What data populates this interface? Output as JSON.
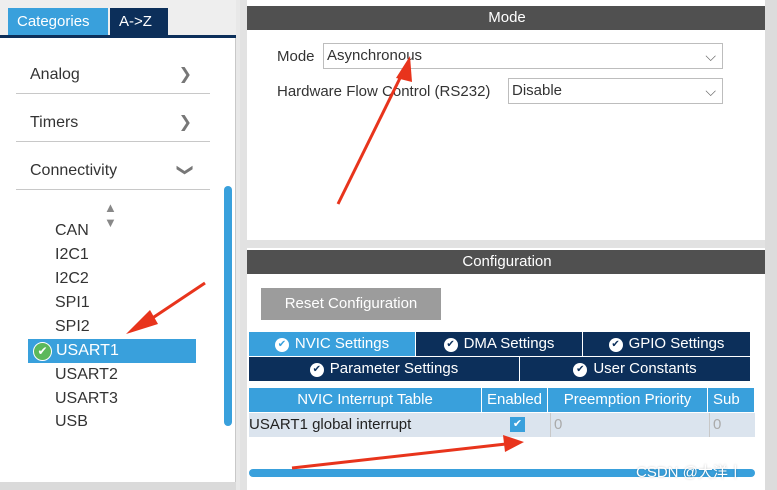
{
  "left_panel": {
    "tabs": [
      {
        "label": "Categories"
      },
      {
        "label": "A->Z"
      }
    ],
    "categories": [
      {
        "label": "Analog",
        "chevron": "chevron-right"
      },
      {
        "label": "Timers",
        "chevron": "chevron-right"
      },
      {
        "label": "Connectivity",
        "chevron": "chevron-down"
      }
    ],
    "peripherals": [
      "CAN",
      "I2C1",
      "I2C2",
      "SPI1",
      "SPI2",
      "USART1",
      "USART2",
      "USART3",
      "USB"
    ],
    "selected_peripheral": "USART1"
  },
  "mode": {
    "header": "Mode",
    "mode_label": "Mode",
    "mode_value": "Asynchronous",
    "flow_label": "Hardware Flow Control (RS232)",
    "flow_value": "Disable"
  },
  "configuration": {
    "header": "Configuration",
    "reset_button": "Reset Configuration",
    "tabs_row1": [
      "NVIC Settings",
      "DMA Settings",
      "GPIO Settings"
    ],
    "tabs_row2": [
      "Parameter Settings",
      "User Constants"
    ],
    "active_tab": "NVIC Settings",
    "table": {
      "columns": [
        "NVIC Interrupt Table",
        "Enabled",
        "Preemption Priority",
        "Sub"
      ],
      "rows": [
        {
          "name": "USART1 global interrupt",
          "enabled": true,
          "preemption": "0",
          "sub": "0"
        }
      ]
    }
  },
  "watermark": "CSDN @大洋丨",
  "colors": {
    "accent": "#39a0dc",
    "dark_navy": "#0c2f5a",
    "header_grey": "#505050",
    "annotation_red": "#e8341c"
  }
}
